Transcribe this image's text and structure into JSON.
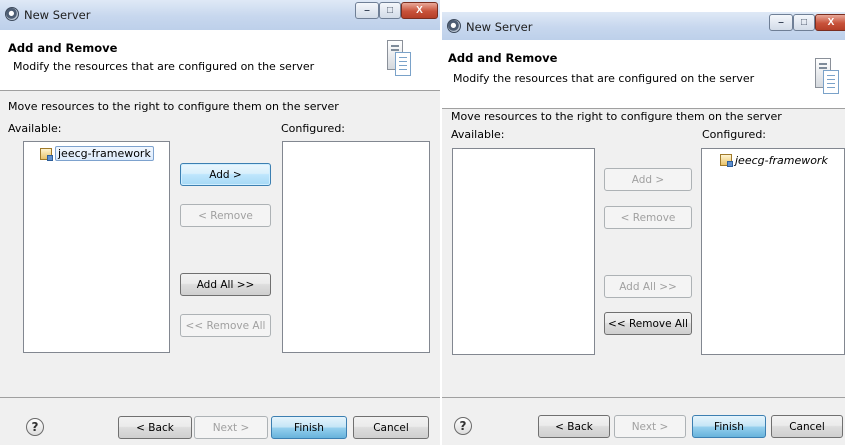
{
  "left_dialog": {
    "title": "New Server",
    "header_title": "Add and Remove",
    "header_desc": "Modify the resources that are configured on the server",
    "instruction": "Move resources to the right to configure them on the server",
    "available_label": "Available:",
    "configured_label": "Configured:",
    "available_items": [
      "jeecg-framework"
    ],
    "configured_items": [],
    "buttons": {
      "add": "Add >",
      "remove": "< Remove",
      "add_all": "Add All >>",
      "remove_all": "<< Remove All"
    },
    "footer": {
      "back": "< Back",
      "next": "Next >",
      "finish": "Finish",
      "cancel": "Cancel"
    },
    "window_controls": {
      "minimize": "–",
      "maximize": "□",
      "close": "X"
    }
  },
  "right_dialog": {
    "title": "New Server",
    "header_title": "Add and Remove",
    "header_desc": "Modify the resources that are configured on the server",
    "instruction": "Move resources to the right to configure them on the server",
    "available_label": "Available:",
    "configured_label": "Configured:",
    "available_items": [],
    "configured_items": [
      "jeecg-framework"
    ],
    "buttons": {
      "add": "Add >",
      "remove": "< Remove",
      "add_all": "Add All >>",
      "remove_all": "<< Remove All"
    },
    "footer": {
      "back": "< Back",
      "next": "Next >",
      "finish": "Finish",
      "cancel": "Cancel"
    },
    "window_controls": {
      "minimize": "–",
      "maximize": "□",
      "close": "X"
    }
  },
  "help_symbol": "?",
  "colors": {
    "accent_border": "#3c7fb1",
    "disabled_text": "#a0a0a0",
    "titlebar": "#c7d7ee"
  },
  "icons": {
    "app": "eclipse-icon",
    "header": "server-icon",
    "project": "project-icon",
    "help": "help-icon"
  }
}
